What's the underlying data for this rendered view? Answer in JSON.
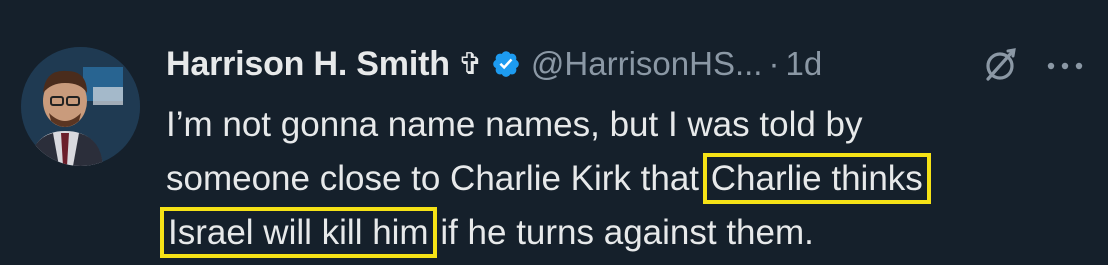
{
  "tweet": {
    "author_name": "Harrison H. Smith",
    "cross_glyph": "✞",
    "handle": "@HarrisonHS...",
    "separator": "·",
    "time": "1d",
    "text": {
      "line1": "I’m not gonna name names, but I was told by",
      "line2_a": "someone close to Charlie Kirk that ",
      "line2_hl": "Charlie thinks",
      "line3_hl": "Israel will kill him",
      "line3_b": " if he turns against them."
    }
  },
  "colors": {
    "background": "#15202b",
    "text": "#e7e9ea",
    "secondary": "#8b98a5",
    "verified": "#1d9bf0",
    "highlight": "#f5e216"
  },
  "icons": {
    "verified": "verified-badge-icon",
    "grok": "grok-icon",
    "more": "more-dots-icon"
  }
}
